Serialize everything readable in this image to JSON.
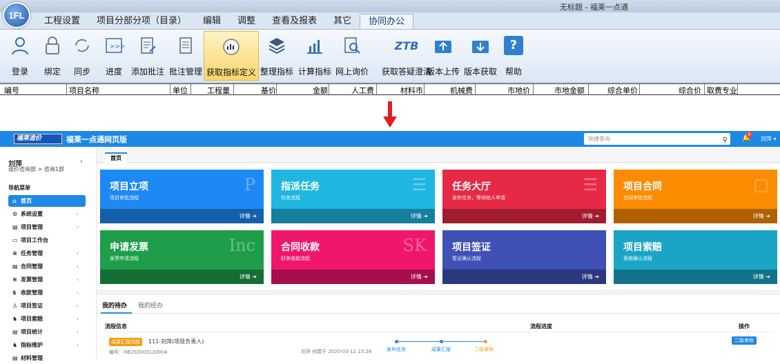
{
  "window_title": "无标题 - 福莱一点通",
  "logo_text": "1FL",
  "menus": [
    "工程设置",
    "项目分部分项（目录）",
    "编辑",
    "调整",
    "查看及报表",
    "其它",
    "协同办公"
  ],
  "ribbon": [
    {
      "label": "登录",
      "icon": "person-icon"
    },
    {
      "label": "绑定",
      "icon": "lock-icon"
    },
    {
      "label": "同步",
      "icon": "sync-icon"
    },
    {
      "label": "进度",
      "icon": "progress-icon"
    },
    {
      "label": "添加批注",
      "icon": "add-note-icon"
    },
    {
      "label": "批注管理",
      "icon": "note-manage-icon"
    },
    {
      "label": "获取指标定义",
      "icon": "gauge-icon"
    },
    {
      "label": "整理指标",
      "icon": "layers-icon"
    },
    {
      "label": "计算指标",
      "icon": "chart-icon"
    },
    {
      "label": "网上询价",
      "icon": "web-search-icon"
    },
    {
      "label": "获取答疑澄清",
      "icon": "ztb-icon",
      "glyph": "ZTB"
    },
    {
      "label": "版本上传",
      "icon": "upload-icon"
    },
    {
      "label": "版本获取",
      "icon": "download-icon"
    },
    {
      "label": "帮助",
      "icon": "help-icon",
      "glyph": "?"
    }
  ],
  "columns": [
    "编号",
    "项目名称",
    "单位",
    "工程量",
    "基价",
    "金额",
    "人工费",
    "材料市",
    "机械费",
    "市地价",
    "市地金额",
    "综合单价",
    "综合价",
    "取费专业"
  ],
  "web": {
    "logo": "福莱造价",
    "title": "福莱一点通网页版",
    "search_placeholder": "快捷查询",
    "badge": "0",
    "user": "刘萍",
    "profile_name": "刘萍",
    "profile_dept": "造价咨询部 > 咨询1部",
    "nav_title": "导航菜单",
    "nav": [
      "首页",
      "系统设置",
      "项目管理",
      "项目工作台",
      "任务管理",
      "合同管理",
      "发票管理",
      "收款管理",
      "项目签证",
      "项目索赔",
      "项目统计",
      "指标维护",
      "材料管理"
    ],
    "tab_home": "首页",
    "cards": [
      {
        "title": "项目立项",
        "sub": "项目审批流程",
        "bg": "P",
        "color": "#1e88f5"
      },
      {
        "title": "指派任务",
        "sub": "任务流程",
        "bg": "☰",
        "color": "#20b6e2"
      },
      {
        "title": "任务大厅",
        "sub": "发布任务，等待他人申请",
        "bg": "☰",
        "color": "#e62a45"
      },
      {
        "title": "项目合同",
        "sub": "合同审批流程",
        "bg": "▢",
        "color": "#fb8c00"
      },
      {
        "title": "申请发票",
        "sub": "发票申请流程",
        "bg": "Inc",
        "color": "#1e9e4a"
      },
      {
        "title": "合同收款",
        "sub": "财务收款流程",
        "bg": "SK",
        "color": "#f0166e"
      },
      {
        "title": "项目签证",
        "sub": "签证确认流程",
        "bg": "",
        "color": "#3f51b5"
      },
      {
        "title": "项目索赔",
        "sub": "索赔确认流程",
        "bg": "",
        "color": "#1aa5c6"
      }
    ],
    "card_footer": "详情",
    "tabs": [
      "我的待办",
      "我的经办"
    ],
    "headers": [
      "流程信息",
      "流程进度",
      "操作"
    ],
    "row": {
      "tag": "成果汇报流程",
      "title": "111-刘萍(项目负责人)",
      "no": "编号：HB202003120004",
      "by": "刘萍 创建于 2020-03-12 23:26",
      "steps": [
        "发布任务",
        "成果汇报",
        "二级审核"
      ],
      "action": "二级审核"
    }
  }
}
